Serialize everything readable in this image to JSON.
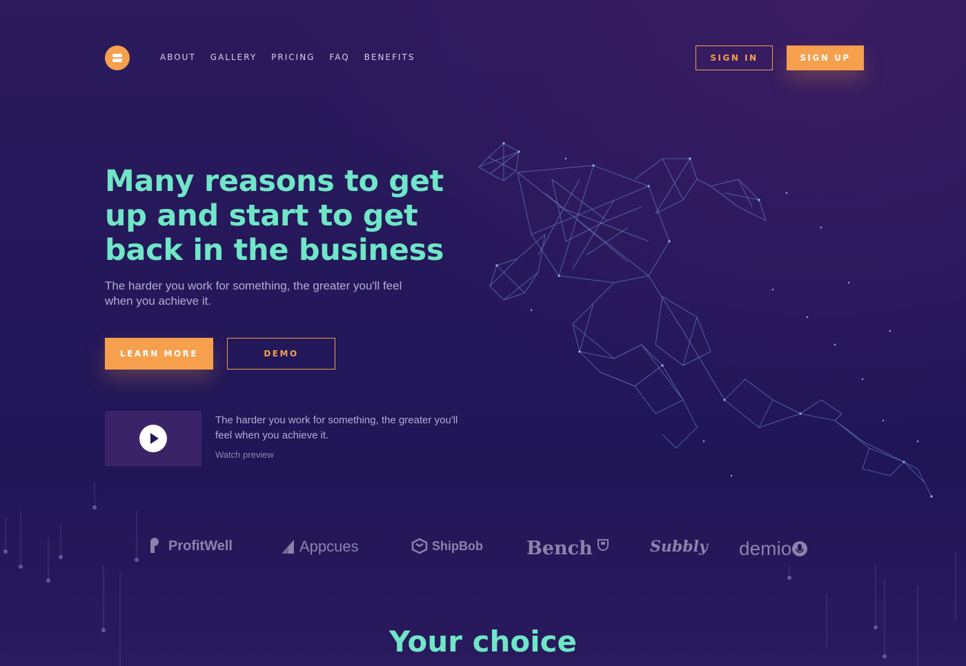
{
  "brand": {
    "logo_icon": "menu-stack-icon",
    "accent": "#f6a04d",
    "headline_color": "#6fe6c6"
  },
  "nav": {
    "items": [
      "ABOUT",
      "GALLERY",
      "PRICING",
      "FAQ",
      "BENEFITS"
    ]
  },
  "auth": {
    "sign_in": "SIGN IN",
    "sign_up": "SIGN UP"
  },
  "hero": {
    "title": "Many reasons to get up and start to get back in the business",
    "subtitle": "The harder you work for something, the greater you'll feel when you achieve it.",
    "learn_more": "LEARN MORE",
    "demo": "DEMO"
  },
  "video": {
    "icon": "play-icon",
    "text": "The harder you work for something, the greater you'll feel when you achieve it.",
    "watch": "Watch preview"
  },
  "partners": [
    {
      "name": "ProfitWell",
      "icon": "profitwell-logo-icon"
    },
    {
      "name": "Appcues",
      "icon": "appcues-logo-icon"
    },
    {
      "name": "ShipBob",
      "icon": "shipbob-logo-icon"
    },
    {
      "name": "Bench",
      "icon": "bench-logo-icon"
    },
    {
      "name": "Subbly",
      "icon": ""
    },
    {
      "name": "demio",
      "icon": "demio-logo-icon"
    }
  ],
  "section": {
    "title": "Your choice"
  }
}
